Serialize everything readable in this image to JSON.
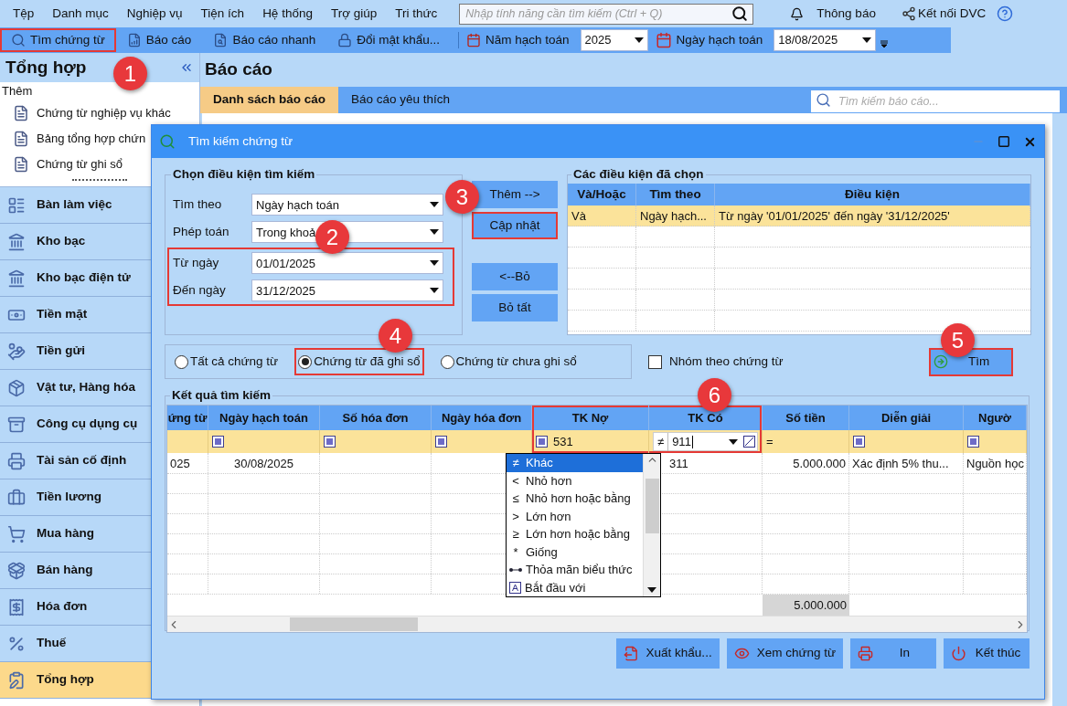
{
  "menu_bar": {
    "items": [
      "Tệp",
      "Danh mục",
      "Nghiệp vụ",
      "Tiện ích",
      "Hệ thống",
      "Trợ giúp",
      "Tri thức"
    ],
    "search": {
      "placeholder": "Nhập tính năng cần tìm kiếm (Ctrl + Q)"
    },
    "notifications": "Thông báo",
    "connect": "Kết nối DVC"
  },
  "toolbar": {
    "buttons": [
      {
        "label": "Tìm chứng từ",
        "highlighted": true
      },
      {
        "label": "Báo cáo",
        "highlighted": false
      },
      {
        "label": "Báo cáo nhanh",
        "highlighted": false
      },
      {
        "label": "Đổi mật khẩu...",
        "highlighted": false
      }
    ],
    "fiscal_year": {
      "label": "Năm hạch toán",
      "value": "2025"
    },
    "posting_date": {
      "label": "Ngày hạch toán",
      "value": "18/08/2025"
    }
  },
  "sidebar": {
    "title": "Tổng hợp",
    "section": "Thêm",
    "links": [
      "Chứng từ nghiệp vụ khác",
      "Bảng tổng hợp chứn",
      "Chứng từ ghi sổ"
    ],
    "nav": [
      {
        "label": "Bàn làm việc",
        "selected": false
      },
      {
        "label": "Kho bạc",
        "selected": false
      },
      {
        "label": "Kho bạc điện tử",
        "selected": false
      },
      {
        "label": "Tiền mặt",
        "selected": false
      },
      {
        "label": "Tiền gửi",
        "selected": false
      },
      {
        "label": "Vật tư, Hàng hóa",
        "selected": false
      },
      {
        "label": "Công cụ dụng cụ",
        "selected": false
      },
      {
        "label": "Tài sản cố định",
        "selected": false
      },
      {
        "label": "Tiền lương",
        "selected": false
      },
      {
        "label": "Mua hàng",
        "selected": false
      },
      {
        "label": "Bán hàng",
        "selected": false
      },
      {
        "label": "Hóa đơn",
        "selected": false
      },
      {
        "label": "Thuế",
        "selected": false
      },
      {
        "label": "Tổng hợp",
        "selected": true
      }
    ]
  },
  "main": {
    "title": "Báo cáo",
    "tabs": [
      {
        "label": "Danh sách báo cáo",
        "selected": true
      },
      {
        "label": "Báo cáo yêu thích",
        "selected": false
      }
    ],
    "search": {
      "placeholder": "Tìm kiếm báo cáo..."
    }
  },
  "dialog": {
    "title": "Tìm kiếm chứng từ",
    "criteria": {
      "title": "Chọn điều kiện tìm kiếm",
      "fields": [
        {
          "label": "Tìm theo",
          "value": "Ngày hạch toán",
          "highlighted": false
        },
        {
          "label": "Phép toán",
          "value": "Trong khoả",
          "highlighted": false
        },
        {
          "label": "Từ ngày",
          "value": "01/01/2025",
          "highlighted": true
        },
        {
          "label": "Đến ngày",
          "value": "31/12/2025",
          "highlighted": true
        }
      ]
    },
    "buttons_top": [
      {
        "label": "Thêm -->",
        "highlighted": false
      },
      {
        "label": "Cập nhật",
        "highlighted": true
      }
    ],
    "buttons_bottom": [
      {
        "label": "<--Bỏ",
        "highlighted": false
      },
      {
        "label": "Bỏ tất",
        "highlighted": false
      }
    ],
    "conditions": {
      "title": "Các điều kiện đã chọn",
      "columns": [
        "Và/Hoặc",
        "Tìm theo",
        "Điều kiện"
      ],
      "rows": [
        {
          "cells": [
            "Và",
            "Ngày hạch...",
            "Từ ngày '01/01/2025' đến ngày '31/12/2025'"
          ],
          "selected": true
        }
      ]
    },
    "scope": [
      {
        "label": "Tất cả chứng từ",
        "selected": false,
        "highlighted": false
      },
      {
        "label": "Chứng từ đã ghi sổ",
        "selected": true,
        "highlighted": true
      },
      {
        "label": "Chứng từ chưa ghi sổ",
        "selected": false,
        "highlighted": false
      }
    ],
    "group_by": {
      "label": "Nhóm theo chứng từ",
      "checked": false
    },
    "search_button": {
      "label": "Tìm",
      "highlighted": true
    },
    "results": {
      "title": "Kết quả tìm kiếm",
      "columns": [
        {
          "header": "ứng từ",
          "highlighted": false,
          "filter": {
            "kind": "blank"
          }
        },
        {
          "header": "Ngày hạch toán",
          "highlighted": false,
          "filter": {
            "kind": "default"
          }
        },
        {
          "header": "Số hóa đơn",
          "highlighted": false,
          "filter": {
            "kind": "default"
          }
        },
        {
          "header": "Ngày hóa đơn",
          "highlighted": false,
          "filter": {
            "kind": "default"
          }
        },
        {
          "header": "TK Nợ",
          "highlighted": true,
          "filter": {
            "kind": "default",
            "value": "531"
          }
        },
        {
          "header": "TK Có",
          "highlighted": true,
          "filter": {
            "kind": "operator",
            "symbol": "≠",
            "value": "911"
          }
        },
        {
          "header": "Số tiền",
          "highlighted": false,
          "filter": {
            "kind": "equals",
            "symbol": "="
          },
          "total": "5.000.000"
        },
        {
          "header": "Diễn giải",
          "highlighted": false,
          "filter": {
            "kind": "default"
          }
        },
        {
          "header": "Ngườ",
          "highlighted": false,
          "filter": {
            "kind": "default"
          }
        }
      ],
      "rows": [
        [
          "025",
          "30/08/2025",
          null,
          null,
          null,
          "311",
          "5.000.000",
          "Xác định 5% thu...",
          "Nguồn học"
        ]
      ],
      "operator_menu": [
        {
          "kind": "symbol",
          "symbol": "≠",
          "label": "Khác",
          "selected": true
        },
        {
          "kind": "symbol",
          "symbol": "<",
          "label": "Nhỏ hơn",
          "selected": false
        },
        {
          "kind": "symbol",
          "symbol": "≤",
          "label": "Nhỏ hơn hoặc bằng",
          "selected": false
        },
        {
          "kind": "symbol",
          "symbol": ">",
          "label": "Lớn hơn",
          "selected": false
        },
        {
          "kind": "symbol",
          "symbol": "≥",
          "label": "Lớn hơn hoặc bằng",
          "selected": false
        },
        {
          "kind": "symbol",
          "symbol": "*",
          "label": "Giống",
          "selected": false
        },
        {
          "kind": "dots",
          "label": "Thỏa mãn biểu thức",
          "selected": false
        },
        {
          "kind": "letter",
          "label": "Bắt đầu với",
          "selected": false
        }
      ]
    },
    "footer_buttons": [
      "Xuất khẩu...",
      "Xem chứng từ",
      "In",
      "Kết thúc"
    ]
  },
  "callouts": [
    "1",
    "2",
    "3",
    "4",
    "5",
    "6"
  ]
}
